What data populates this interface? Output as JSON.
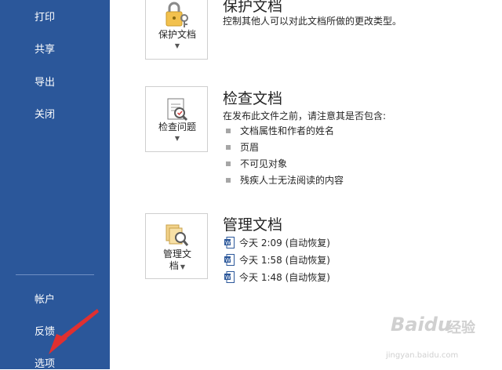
{
  "sidebar": {
    "items": [
      {
        "label": "打印"
      },
      {
        "label": "共享"
      },
      {
        "label": "导出"
      },
      {
        "label": "关闭"
      }
    ],
    "bottom_items": [
      {
        "label": "帐户"
      },
      {
        "label": "反馈"
      },
      {
        "label": "选项"
      }
    ],
    "background_color": "#2b579a"
  },
  "sections": {
    "protect": {
      "title": "保护文档",
      "description": "控制其他人可以对此文档所做的更改类型。",
      "button_label": "保护文档",
      "icon": "lock-icon"
    },
    "inspect": {
      "title": "检查文档",
      "description": "在发布此文件之前，请注意其是否包含:",
      "button_label": "检查问题",
      "icon": "inspect-icon",
      "bullets": [
        "文档属性和作者的姓名",
        "页眉",
        "不可见对象",
        "残疾人士无法阅读的内容"
      ]
    },
    "manage": {
      "title": "管理文档",
      "button_label_line1": "管理文",
      "button_label_line2": "档",
      "icon": "manage-docs-icon",
      "versions": [
        {
          "label": "今天 2:09 (自动恢复)"
        },
        {
          "label": "今天 1:58 (自动恢复)"
        },
        {
          "label": "今天 1:48 (自动恢复)"
        }
      ]
    }
  },
  "watermark": {
    "logo": "Baidu",
    "logo_cn": "经验",
    "url": "jingyan.baidu.com"
  }
}
